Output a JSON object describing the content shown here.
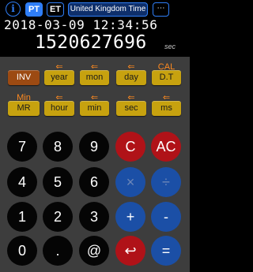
{
  "topbar": {
    "info_icon": "i",
    "pt_label": "PT",
    "et_label": "ET",
    "timezone_label": "United Kingdom Time",
    "more_label": "⋯"
  },
  "display": {
    "datetime": "2018-03-09 12:34:56",
    "epoch": "1520627696",
    "unit": "sec"
  },
  "function_rows": {
    "row1_labels": [
      "",
      "⇐",
      "⇐",
      "⇐",
      "CAL"
    ],
    "row1_buttons": [
      "INV",
      "year",
      "mon",
      "day",
      "D.T"
    ],
    "row2_labels": [
      "Min",
      "⇐",
      "⇐",
      "⇐",
      "⇐"
    ],
    "row2_buttons": [
      "MR",
      "hour",
      "min",
      "sec",
      "ms"
    ]
  },
  "keypad": [
    [
      "7",
      "8",
      "9",
      "C",
      "AC"
    ],
    [
      "4",
      "5",
      "6",
      "×",
      "÷"
    ],
    [
      "1",
      "2",
      "3",
      "+",
      "-"
    ],
    [
      "0",
      ".",
      "@",
      "↩",
      "="
    ]
  ],
  "colors": {
    "accent_blue": "#2f7ef7",
    "function_gold": "#c7a20f",
    "inv_rust": "#9c4a12",
    "label_orange": "#ff8a1f",
    "key_red": "#b01218",
    "key_blue": "#1b4fa6",
    "key_black": "#050505"
  }
}
